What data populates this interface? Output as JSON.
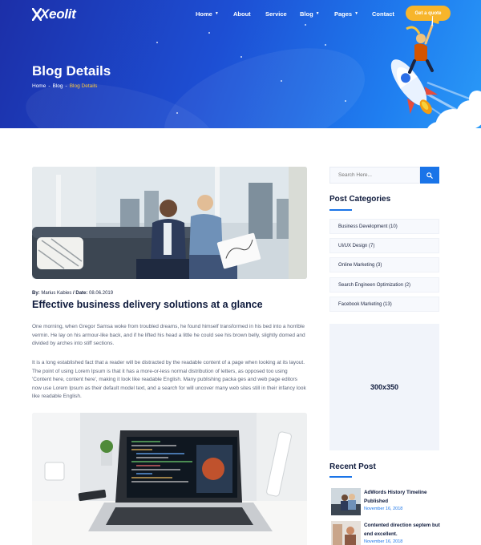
{
  "brand": {
    "logo_text": "Xeolit"
  },
  "nav": {
    "home": "Home",
    "about": "About",
    "service": "Service",
    "blog": "Blog",
    "pages": "Pages",
    "contact": "Contact",
    "quote_button": "Get a quote"
  },
  "hero": {
    "title": "Blog Details",
    "breadcrumb": [
      "Home",
      "-",
      "Blog",
      "-",
      "Blog Details"
    ]
  },
  "post": {
    "meta_by_label": "By:",
    "meta_author": "Marius Kabies",
    "meta_date_label": "/ Date:",
    "meta_date": "08.06.2019",
    "title": "Effective business delivery solutions at a glance",
    "paragraph_1": "One morning, when Gregor Samsa woke from troubled dreams, he found himself transformed in his bed into a horrible vermin. He lay on his armour-like back, and if he lifted his head a little he could see his brown belly, slightly domed and divided by arches into stiff sections.",
    "paragraph_2": "It is a long established fact that a reader will be distracted by the readable content of a page when looking at its layout. The point of using Lorem Ipsum is that it has a more-or-less normal distribution of letters, as opposed too using 'Content here, content here', making it look like readable English. Many publishing packa ges and web page editors now use Lorem Ipsum as their default model text, and a search for will uncover many web sites still in their infancy look like readable English."
  },
  "sidebar": {
    "search_placeholder": "Search Here...",
    "categories_heading": "Post Categories",
    "categories": [
      "Business Development (10)",
      "UI/UX Design (7)",
      "Online Marketing (3)",
      "Search Engineen Optimization (2)",
      "Facebook Marketing (13)"
    ],
    "ad_label": "300x350",
    "recent_heading": "Recent Post",
    "recent_posts": [
      {
        "title_line1": "AdWords History Timeline",
        "title_line2": "Published",
        "date": "November 16, 2018"
      },
      {
        "title_line1": "Contented direction septem but",
        "title_line2": "end excellent.",
        "date": "November 16, 2018"
      }
    ]
  },
  "colors": {
    "accent": "#1a74e8",
    "quote_button": "#f7b52b",
    "breadcrumb_current": "#f7c53b",
    "hero_gradient_start": "#1c2fa8",
    "hero_gradient_end": "#2a9af7"
  }
}
